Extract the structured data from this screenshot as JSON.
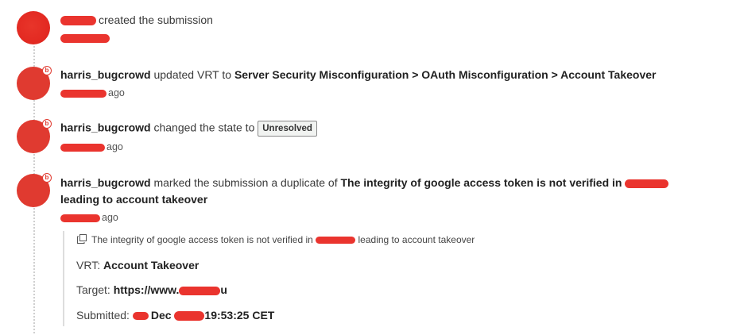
{
  "event1": {
    "action": "created the submission"
  },
  "event2": {
    "user": "harris_bugcrowd",
    "action": "updated VRT to",
    "vrt": "Server Security Misconfiguration > OAuth Misconfiguration > Account Takeover",
    "time_suffix": "ago"
  },
  "event3": {
    "user": "harris_bugcrowd",
    "action": "changed the state to",
    "state": "Unresolved",
    "time_suffix": "ago"
  },
  "event4": {
    "user": "harris_bugcrowd",
    "action": "marked the submission a duplicate of",
    "target_title_part1": "The integrity of google access token is not verified in",
    "target_title_part2": "leading to account takeover",
    "time_suffix": "ago",
    "duplicate": {
      "title_part1": "The integrity of google access token is not verified in",
      "title_part2": "leading to account takeover",
      "vrt_label": "VRT:",
      "vrt_value": "Account Takeover",
      "target_label": "Target:",
      "target_value_prefix": "https://www.",
      "target_value_suffix": "u",
      "submitted_label": "Submitted:",
      "submitted_month": "Dec",
      "submitted_time": "19:53:25 CET"
    }
  },
  "colors": {
    "avatar_red": "#e32a22",
    "redaction_red": "#e8231c",
    "text": "#3a3a3a",
    "timeline_dots": "#cfcfcf"
  },
  "icons": {
    "bugcrowd_badge": "b",
    "copy_icon": "duplicate-copy-icon"
  }
}
